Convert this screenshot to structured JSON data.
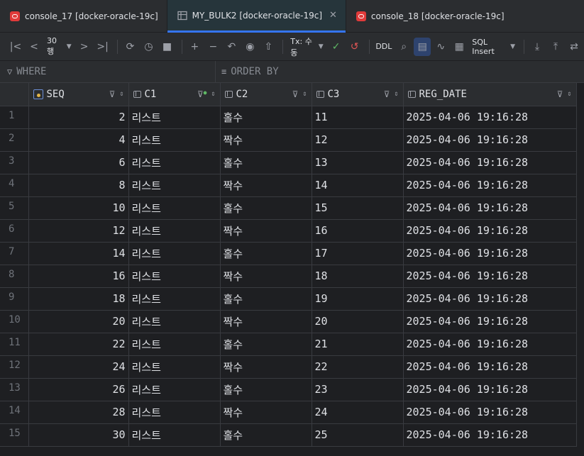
{
  "tabs": [
    {
      "label": "console_17 [docker-oracle-19c]",
      "icon": "oracle-icon",
      "active": false
    },
    {
      "label": "MY_BULK2 [docker-oracle-19c]",
      "icon": "table-icon",
      "active": true
    },
    {
      "label": "console_18 [docker-oracle-19c]",
      "icon": "oracle-icon",
      "active": false
    }
  ],
  "toolbar": {
    "page_size": "30 행",
    "tx_mode": "Tx: 수동",
    "ddl": "DDL",
    "export_format": "SQL Insert"
  },
  "filter": {
    "where_label": "WHERE",
    "order_label": "ORDER BY"
  },
  "columns": [
    "SEQ",
    "C1",
    "C2",
    "C3",
    "REG_DATE"
  ],
  "rows": [
    {
      "n": "1",
      "seq": "2",
      "c1": "리스트",
      "c2": "홀수",
      "c3": "11",
      "reg": "2025-04-06 19:16:28"
    },
    {
      "n": "2",
      "seq": "4",
      "c1": "리스트",
      "c2": "짝수",
      "c3": "12",
      "reg": "2025-04-06 19:16:28"
    },
    {
      "n": "3",
      "seq": "6",
      "c1": "리스트",
      "c2": "홀수",
      "c3": "13",
      "reg": "2025-04-06 19:16:28"
    },
    {
      "n": "4",
      "seq": "8",
      "c1": "리스트",
      "c2": "짝수",
      "c3": "14",
      "reg": "2025-04-06 19:16:28"
    },
    {
      "n": "5",
      "seq": "10",
      "c1": "리스트",
      "c2": "홀수",
      "c3": "15",
      "reg": "2025-04-06 19:16:28"
    },
    {
      "n": "6",
      "seq": "12",
      "c1": "리스트",
      "c2": "짝수",
      "c3": "16",
      "reg": "2025-04-06 19:16:28"
    },
    {
      "n": "7",
      "seq": "14",
      "c1": "리스트",
      "c2": "홀수",
      "c3": "17",
      "reg": "2025-04-06 19:16:28"
    },
    {
      "n": "8",
      "seq": "16",
      "c1": "리스트",
      "c2": "짝수",
      "c3": "18",
      "reg": "2025-04-06 19:16:28"
    },
    {
      "n": "9",
      "seq": "18",
      "c1": "리스트",
      "c2": "홀수",
      "c3": "19",
      "reg": "2025-04-06 19:16:28"
    },
    {
      "n": "10",
      "seq": "20",
      "c1": "리스트",
      "c2": "짝수",
      "c3": "20",
      "reg": "2025-04-06 19:16:28"
    },
    {
      "n": "11",
      "seq": "22",
      "c1": "리스트",
      "c2": "홀수",
      "c3": "21",
      "reg": "2025-04-06 19:16:28"
    },
    {
      "n": "12",
      "seq": "24",
      "c1": "리스트",
      "c2": "짝수",
      "c3": "22",
      "reg": "2025-04-06 19:16:28"
    },
    {
      "n": "13",
      "seq": "26",
      "c1": "리스트",
      "c2": "홀수",
      "c3": "23",
      "reg": "2025-04-06 19:16:28"
    },
    {
      "n": "14",
      "seq": "28",
      "c1": "리스트",
      "c2": "짝수",
      "c3": "24",
      "reg": "2025-04-06 19:16:28"
    },
    {
      "n": "15",
      "seq": "30",
      "c1": "리스트",
      "c2": "홀수",
      "c3": "25",
      "reg": "2025-04-06 19:16:28"
    }
  ]
}
